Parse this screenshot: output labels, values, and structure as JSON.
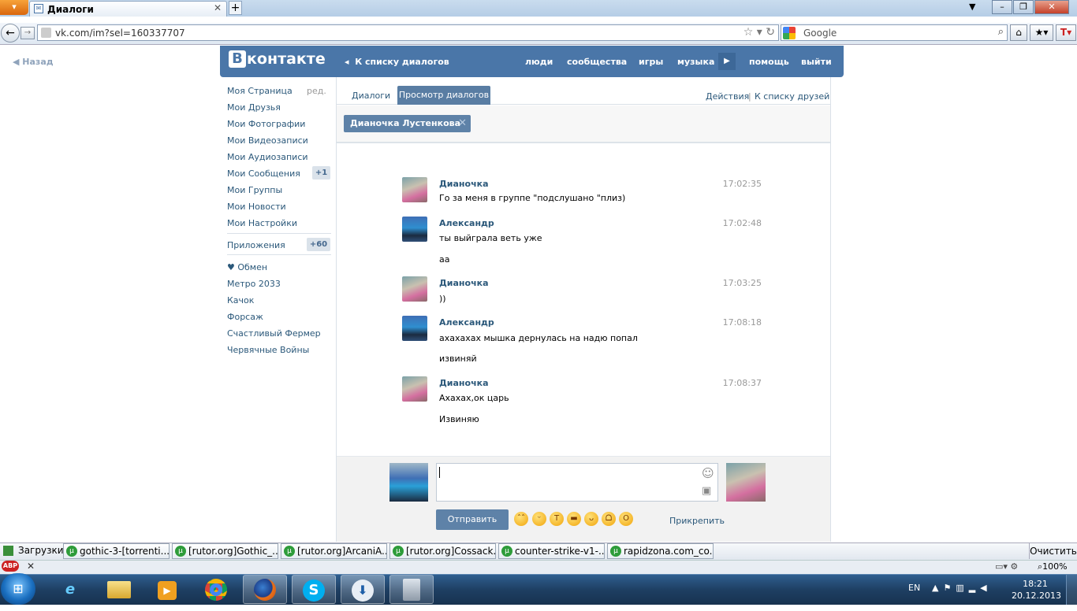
{
  "browser": {
    "menu_label": "Firefox",
    "tab_title": "Диалоги",
    "url": "vk.com/im?sel=160337707",
    "search_placeholder": "Google",
    "new_tab": "+"
  },
  "vk": {
    "logo_letter": "В",
    "logo_text": "контакте",
    "back_to_list": "К списку диалогов",
    "top_nav": [
      "люди",
      "сообщества",
      "игры",
      "музыка",
      "помощь",
      "выйти"
    ],
    "back": "Назад",
    "menu": {
      "my_page": "Моя Страница",
      "edit": "ред.",
      "friends": "Мои Друзья",
      "photos": "Мои Фотографии",
      "videos": "Мои Видеозаписи",
      "audios": "Мои Аудиозаписи",
      "messages": "Мои Сообщения",
      "messages_badge": "+1",
      "groups": "Мои Группы",
      "news": "Мои Новости",
      "settings": "Мои Настройки",
      "apps": "Приложения",
      "apps_badge": "+60",
      "app_items": [
        "♥ Обмен",
        "Метро 2033",
        "Качок",
        "Форсаж",
        "Счастливый Фермер",
        "Червячные Войны"
      ]
    },
    "tabs": {
      "dialogs": "Диалоги",
      "view": "Просмотр диалогов",
      "actions": "Действия",
      "separator": "|",
      "to_friends": "К списку друзей"
    },
    "peer_name": "Дианочка Лустенкова",
    "messages": [
      {
        "author": "Дианочка",
        "time": "17:02:35",
        "lines": [
          "Го за меня в группе \"подслушано \"плиз)"
        ],
        "avatar": "diana"
      },
      {
        "author": "Александр",
        "time": "17:02:48",
        "lines": [
          "ты выйграла веть уже",
          "аа"
        ],
        "avatar": "alex"
      },
      {
        "author": "Дианочка",
        "time": "17:03:25",
        "lines": [
          "))"
        ],
        "avatar": "diana"
      },
      {
        "author": "Александр",
        "time": "17:08:18",
        "lines": [
          "ахахахах мышка дернулась на надю попал",
          "извиняй"
        ],
        "avatar": "alex"
      },
      {
        "author": "Дианочка",
        "time": "17:08:37",
        "lines": [
          "Ахахах,ок царь",
          "Извиняю"
        ],
        "avatar": "diana"
      }
    ],
    "compose": {
      "value": "",
      "send": "Отправить",
      "attach": "Прикрепить",
      "emoji_count": 7
    }
  },
  "downloads": {
    "label": "Загрузки",
    "items": [
      "gothic-3-[torrenti...",
      "[rutor.org]Gothic_...",
      "[rutor.org]ArcaniA...",
      "[rutor.org]Cossack...",
      "counter-strike-v1-...",
      "rapidzona.com_co..."
    ],
    "clear": "Очистить"
  },
  "statusbar": {
    "close": "✕",
    "zoom": "100%",
    "abp": "ABP"
  },
  "taskbar": {
    "lang": "EN",
    "time": "18:21",
    "date": "20.12.2013"
  }
}
